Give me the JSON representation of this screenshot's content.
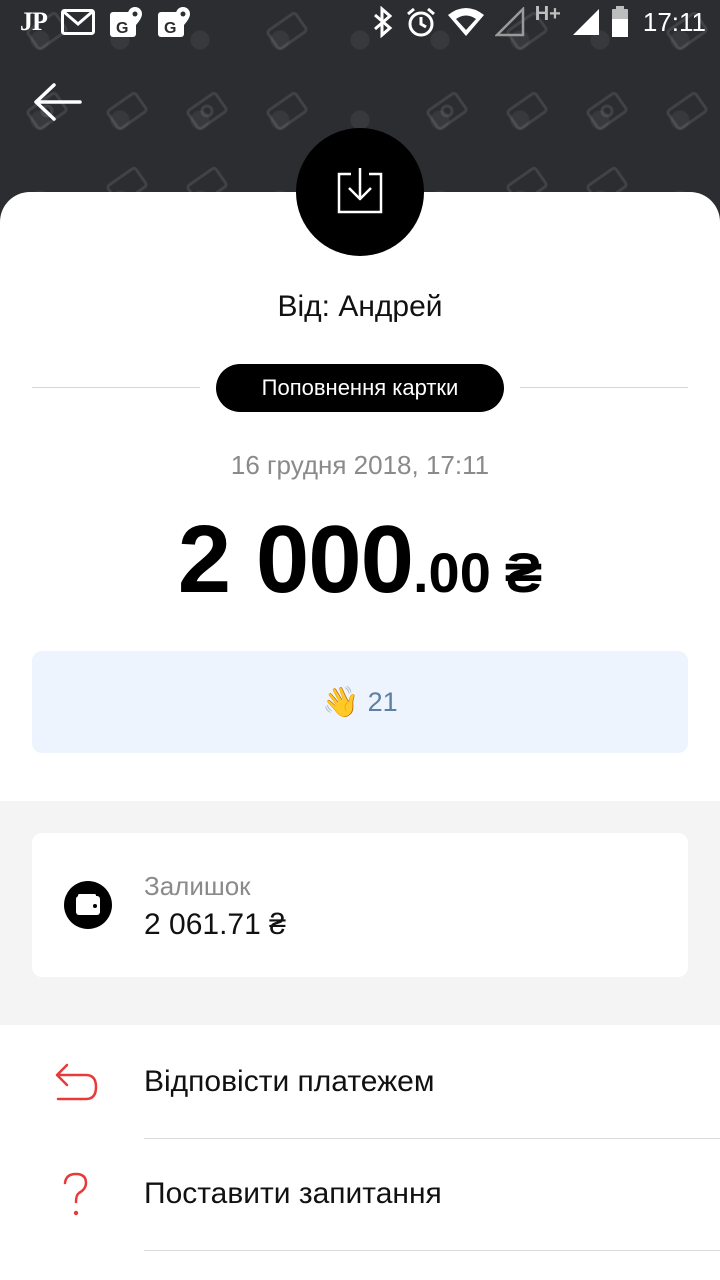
{
  "status_bar": {
    "carrier_badge": "JP",
    "network_type": "H+",
    "time": "17:11",
    "left_icons": [
      "gmail-icon",
      "maps-icon",
      "maps-icon"
    ],
    "right_icons": [
      "bluetooth-icon",
      "alarm-icon",
      "wifi-icon",
      "signal-icon",
      "battery-icon"
    ]
  },
  "header": {
    "back_icon": "back-arrow-icon",
    "type_icon": "download-tray-icon"
  },
  "transaction": {
    "from": "Від: Андрей",
    "type": "Поповнення картки",
    "date": "16 грудня 2018, 17:11",
    "amount_main": "2 000",
    "amount_decimal": ".00",
    "currency": "₴"
  },
  "reactions": {
    "emoji": "👋",
    "count": "21"
  },
  "balance": {
    "label": "Залишок",
    "value": "2 061.71 ₴",
    "icon": "wallet-icon"
  },
  "actions": [
    {
      "label": "Відповісти платежем",
      "icon": "reply-arrow-icon"
    },
    {
      "label": "Поставити запитання",
      "icon": "question-mark-icon"
    }
  ],
  "colors": {
    "header_bg": "#2c2d31",
    "accent_red": "#e83a3a",
    "reaction_bg": "#edf4fd",
    "reaction_text": "#5d7fa4"
  }
}
